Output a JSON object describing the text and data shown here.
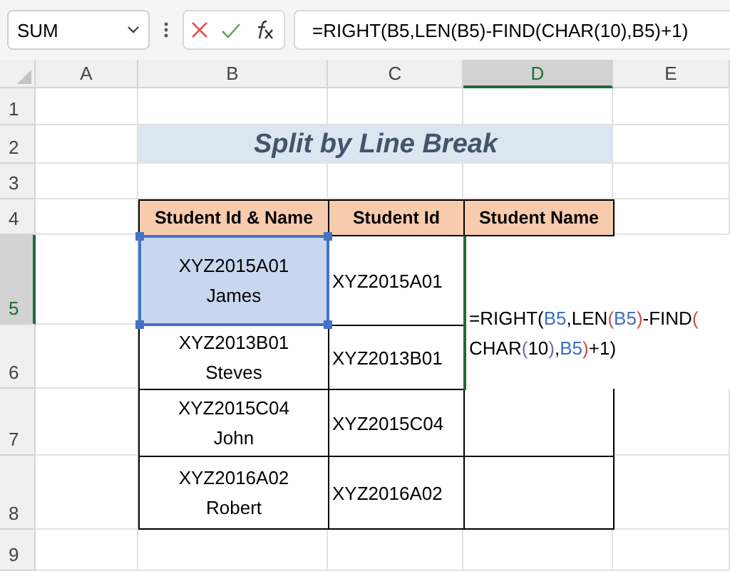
{
  "name_box": {
    "value": "SUM"
  },
  "formula_bar": {
    "value": "=RIGHT(B5,LEN(B5)-FIND(CHAR(10),B5)+1)"
  },
  "columns": [
    {
      "label": "A",
      "selected": false
    },
    {
      "label": "B",
      "selected": false
    },
    {
      "label": "C",
      "selected": false
    },
    {
      "label": "D",
      "selected": true
    },
    {
      "label": "E",
      "selected": false
    }
  ],
  "rows": [
    {
      "label": "1",
      "selected": false
    },
    {
      "label": "2",
      "selected": false
    },
    {
      "label": "3",
      "selected": false
    },
    {
      "label": "4",
      "selected": false
    },
    {
      "label": "5",
      "selected": true
    },
    {
      "label": "6",
      "selected": false
    },
    {
      "label": "7",
      "selected": false
    },
    {
      "label": "8",
      "selected": false
    },
    {
      "label": "9",
      "selected": false
    }
  ],
  "title": "Split by Line Break",
  "table": {
    "columns": [
      "Student Id & Name",
      "Student Id",
      "Student Name"
    ],
    "rows": [
      {
        "id_and_name": [
          "XYZ2015A01",
          "James"
        ],
        "id": "XYZ2015A01",
        "selected": true
      },
      {
        "id_and_name": [
          "XYZ2013B01",
          "Steves"
        ],
        "id": "XYZ2013B01",
        "selected": false
      },
      {
        "id_and_name": [
          "XYZ2015C04",
          "John"
        ],
        "id": "XYZ2015C04",
        "selected": false
      },
      {
        "id_and_name": [
          "XYZ2016A02",
          "Robert"
        ],
        "id": "XYZ2016A02",
        "selected": false
      }
    ]
  },
  "editing_cell": {
    "lines": [
      [
        {
          "text": "=RIGHT(",
          "color": "#000000"
        },
        {
          "text": "B5",
          "color": "#3a6fc4"
        },
        {
          "text": ",LEN",
          "color": "#000000"
        },
        {
          "text": "(",
          "color": "#c0504d"
        },
        {
          "text": "B5",
          "color": "#3a6fc4"
        },
        {
          "text": ")",
          "color": "#c0504d"
        },
        {
          "text": "-FIND",
          "color": "#000000"
        },
        {
          "text": "(",
          "color": "#c0504d"
        }
      ],
      [
        {
          "text": "CHAR",
          "color": "#000000"
        },
        {
          "text": "(",
          "color": "#8064a2"
        },
        {
          "text": "10",
          "color": "#000000"
        },
        {
          "text": ")",
          "color": "#8064a2"
        },
        {
          "text": ",",
          "color": "#000000"
        },
        {
          "text": "B5",
          "color": "#3a6fc4"
        },
        {
          "text": ")",
          "color": "#c0504d"
        },
        {
          "text": "+1)",
          "color": "#000000"
        }
      ]
    ]
  }
}
